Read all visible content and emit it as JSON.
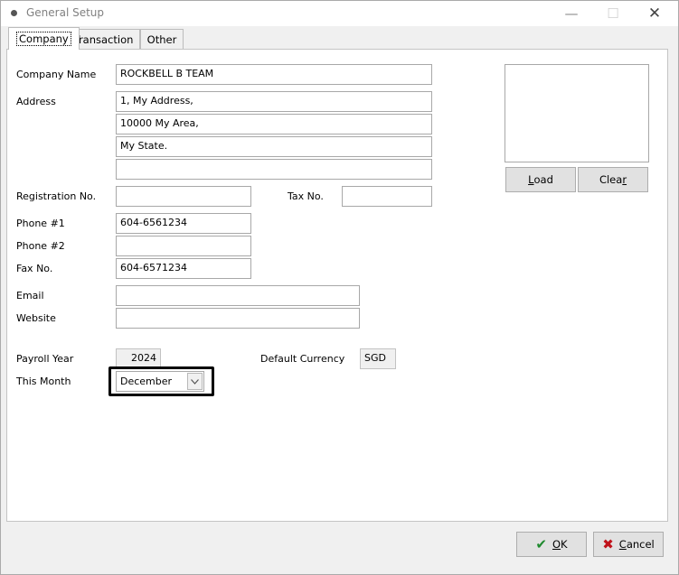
{
  "window": {
    "title": "General Setup",
    "minimize": "—",
    "maximize": "☐",
    "close": "✕"
  },
  "tabs": [
    {
      "label": "Company"
    },
    {
      "label": "Transaction"
    },
    {
      "label": "Other"
    }
  ],
  "company": {
    "company_name_label": "Company Name",
    "company_name_value": "ROCKBELL B TEAM",
    "address_label": "Address",
    "address_lines": [
      "1, My Address,",
      "10000 My Area,",
      "My State.",
      ""
    ],
    "registration_label": "Registration No.",
    "registration_value": "",
    "tax_label": "Tax No.",
    "tax_value": "",
    "phone1_label": "Phone #1",
    "phone1_value": "604-6561234",
    "phone2_label": "Phone #2",
    "phone2_value": "",
    "fax_label": "Fax No.",
    "fax_value": "604-6571234",
    "email_label": "Email",
    "email_value": "",
    "website_label": "Website",
    "website_value": "",
    "payroll_year_label": "Payroll Year",
    "payroll_year_value": "2024",
    "currency_label": "Default Currency",
    "currency_value": "SGD",
    "this_month_label": "This Month",
    "this_month_value": "December"
  },
  "logo_buttons": {
    "load": "L",
    "load_rest": "oad",
    "clear": "Clea",
    "clear_rest": "r"
  },
  "footer": {
    "ok_mark": "✔",
    "ok_u": "O",
    "ok_rest": "K",
    "cancel_mark": "✖",
    "cancel_u": "C",
    "cancel_rest": "ancel"
  }
}
